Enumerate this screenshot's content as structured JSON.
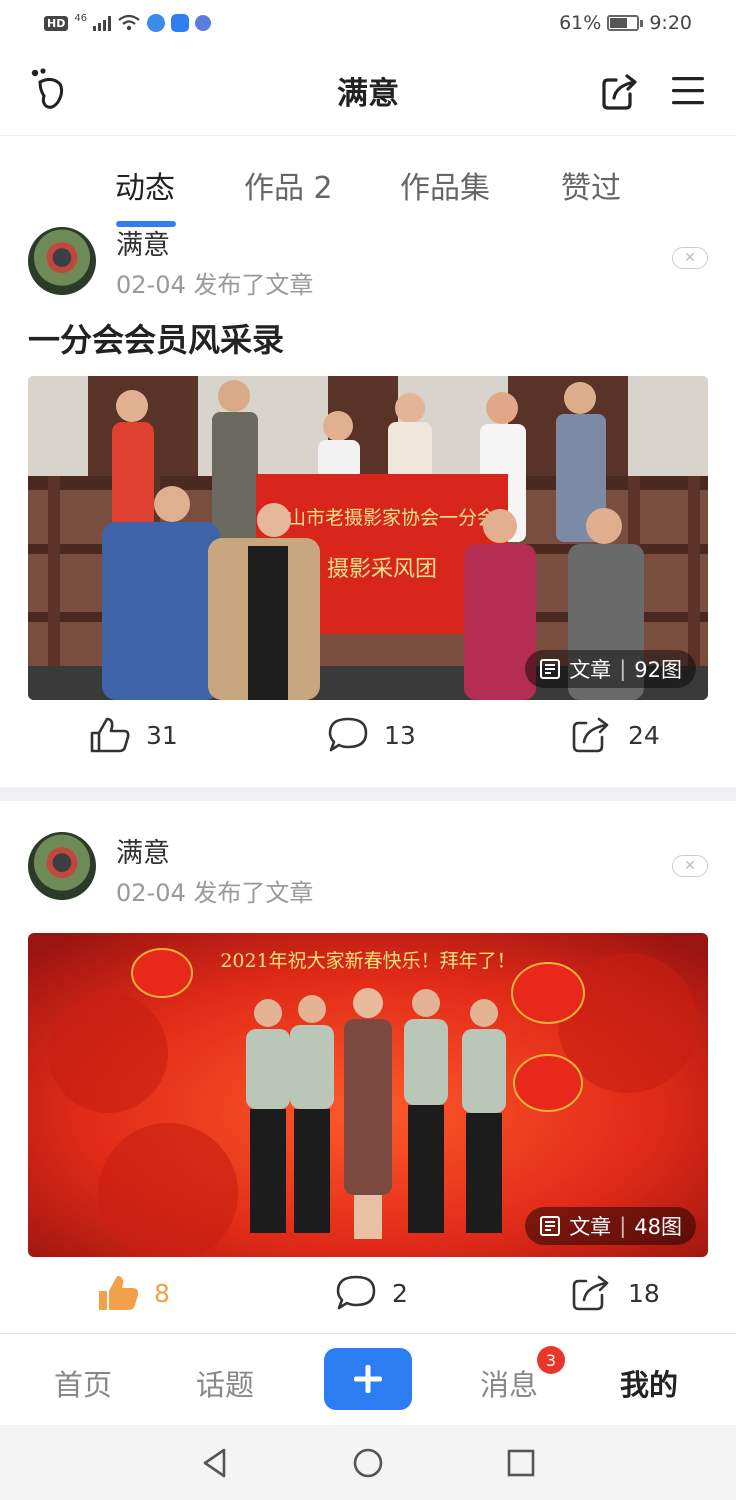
{
  "status_bar": {
    "hd": "HD",
    "network": "46",
    "battery": "61%",
    "time": "9:20"
  },
  "header": {
    "title": "满意"
  },
  "tabs": [
    {
      "label": "动态",
      "active": true
    },
    {
      "label": "作品 2",
      "active": false
    },
    {
      "label": "作品集",
      "active": false
    },
    {
      "label": "赞过",
      "active": false
    }
  ],
  "posts": [
    {
      "author": "满意",
      "meta": "02-04 发布了文章",
      "title": "一分会会员风采录",
      "badge_type": "文章",
      "badge_count": "92图",
      "likes": "31",
      "comments": "13",
      "shares": "24",
      "liked": false
    },
    {
      "author": "满意",
      "meta": "02-04 发布了文章",
      "title": "",
      "banner_text": "2021年祝大家新春快乐！拜年了！",
      "badge_type": "文章",
      "badge_count": "48图",
      "likes": "8",
      "comments": "2",
      "shares": "18",
      "liked": true
    }
  ],
  "photo1_banner": "唐山市老摄影家协会一分会",
  "photo1_banner_line2": "摄影采风团",
  "bottom_nav": {
    "home": "首页",
    "topics": "话题",
    "messages": "消息",
    "messages_badge": "3",
    "mine": "我的"
  },
  "colors": {
    "accent": "#2d7df2",
    "badge_red": "#e8362b",
    "like_orange": "#f2a14a"
  }
}
